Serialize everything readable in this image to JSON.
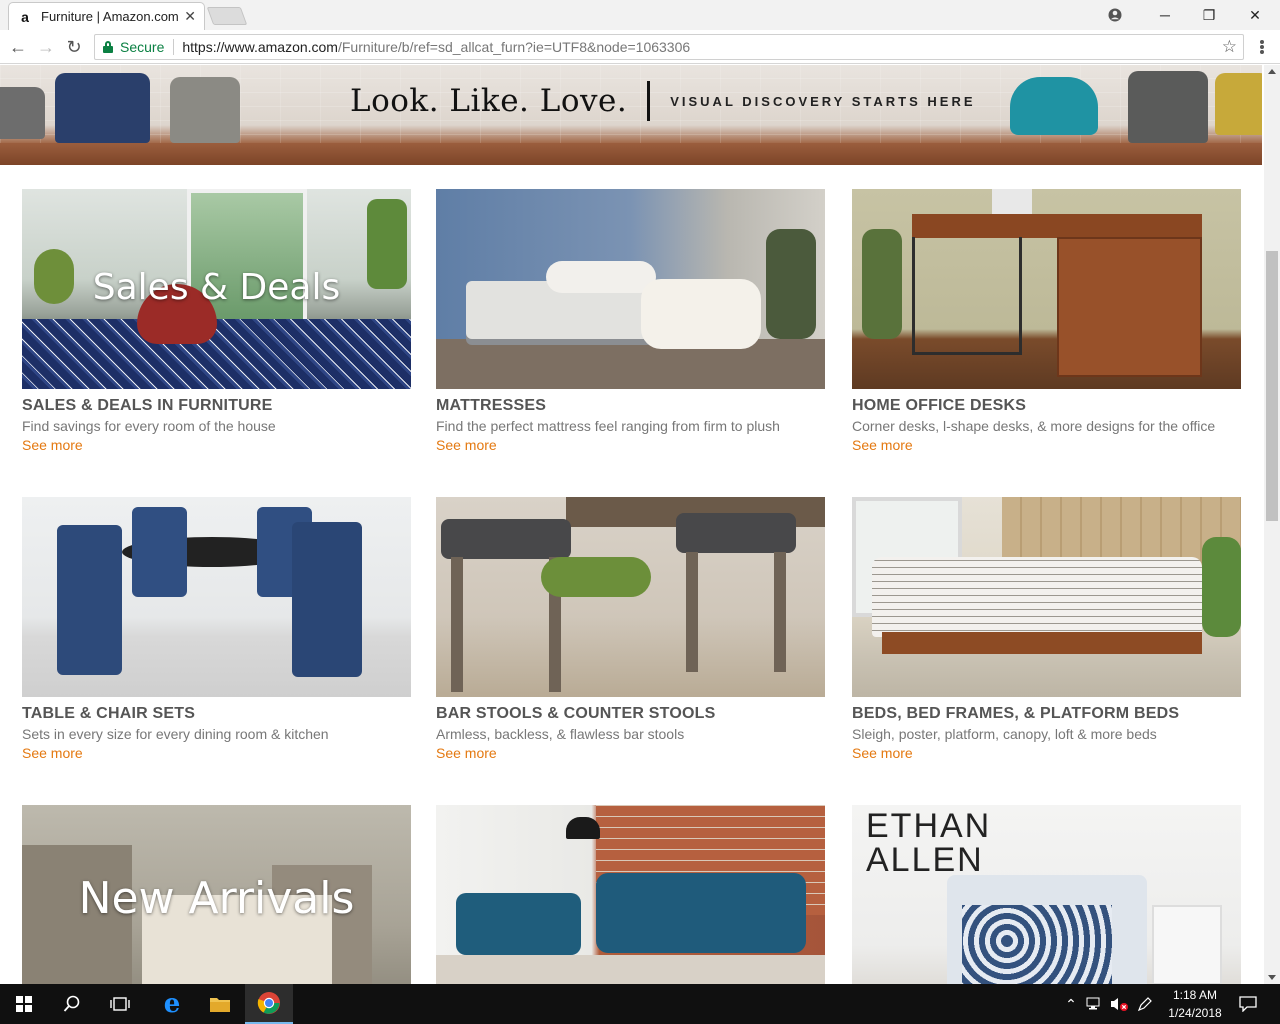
{
  "browser": {
    "tab_title": "Furniture | Amazon.com",
    "favicon": "a",
    "secure_label": "Secure",
    "url_host": "https://www.amazon.com",
    "url_path": "/Furniture/b/ref=sd_allcat_furn?ie=UTF8&node=1063306"
  },
  "banner": {
    "headline": "Look. Like. Love.",
    "tagline": "VISUAL DISCOVERY STARTS HERE"
  },
  "cards": [
    {
      "overlay": "Sales & Deals",
      "title": "SALES & DEALS IN FURNITURE",
      "desc": "Find savings for every room of the house",
      "more": "See more"
    },
    {
      "overlay": "",
      "title": "MATTRESSES",
      "desc": "Find the perfect mattress feel ranging from firm to plush",
      "more": "See more"
    },
    {
      "overlay": "",
      "title": "HOME OFFICE DESKS",
      "desc": "Corner desks, l-shape desks, & more designs for the office",
      "more": "See more"
    },
    {
      "overlay": "",
      "title": "TABLE & CHAIR SETS",
      "desc": "Sets in every size for every dining room & kitchen",
      "more": "See more"
    },
    {
      "overlay": "",
      "title": "BAR STOOLS & COUNTER STOOLS",
      "desc": "Armless, backless, & flawless bar stools",
      "more": "See more"
    },
    {
      "overlay": "",
      "title": "BEDS, BED FRAMES, & PLATFORM BEDS",
      "desc": "Sleigh, poster, platform, canopy, loft & more beds",
      "more": "See more"
    },
    {
      "overlay": "New Arrivals",
      "title": "",
      "desc": "",
      "more": ""
    },
    {
      "overlay": "",
      "title": "",
      "desc": "",
      "more": ""
    },
    {
      "overlay": "ETHAN ALLEN",
      "title": "",
      "desc": "",
      "more": ""
    }
  ],
  "taskbar": {
    "time": "1:18 AM",
    "date": "1/24/2018"
  },
  "colors": {
    "see_more": "#e47911",
    "secure_green": "#0b8043",
    "title_gray": "#555555"
  }
}
